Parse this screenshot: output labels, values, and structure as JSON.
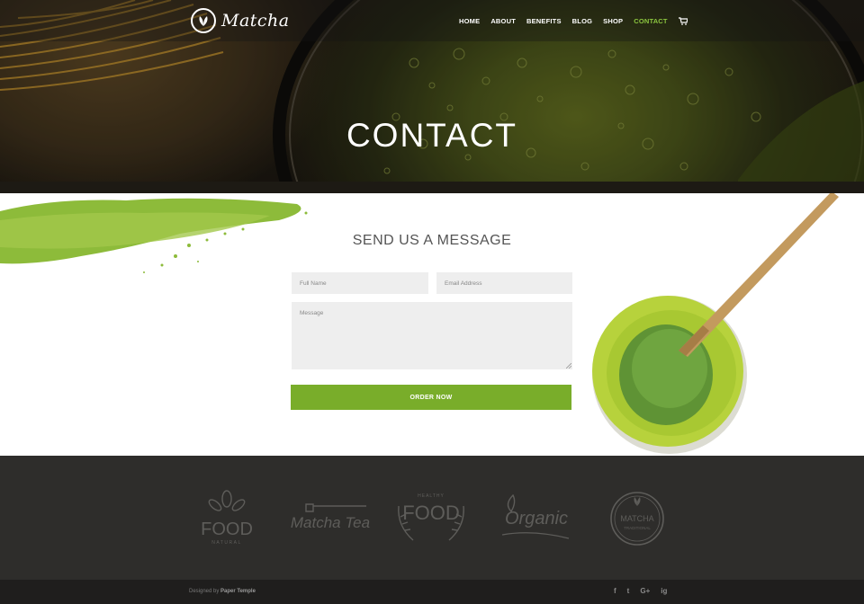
{
  "brand": {
    "name": "Matcha"
  },
  "nav": {
    "items": [
      "HOME",
      "ABOUT",
      "BENEFITS",
      "BLOG",
      "SHOP",
      "CONTACT"
    ],
    "active": "CONTACT"
  },
  "hero": {
    "title": "CONTACT"
  },
  "form": {
    "title": "SEND US A MESSAGE",
    "name_placeholder": "Full Name",
    "email_placeholder": "Email Address",
    "message_placeholder": "Message",
    "submit_label": "ORDER NOW"
  },
  "footer_logos": {
    "food_natural": {
      "word": "FOOD",
      "sub": "NATURAL"
    },
    "matcha_tea": {
      "word": "Matcha Tea"
    },
    "healthy_food": {
      "top": "HEALTHY",
      "word": "FOOD"
    },
    "organic": {
      "word": "Organic"
    },
    "matcha_traditional": {
      "word": "MATCHA",
      "sub": "TRADITIONAL"
    }
  },
  "bottom": {
    "credit_prefix": "Designed by",
    "credit_name": "Paper Temple",
    "social": [
      "f",
      "t",
      "G+",
      "ig"
    ]
  },
  "colors": {
    "accent": "#79ad2a",
    "active_nav": "#8cc63f",
    "footer_bg": "#2e2d2b"
  }
}
